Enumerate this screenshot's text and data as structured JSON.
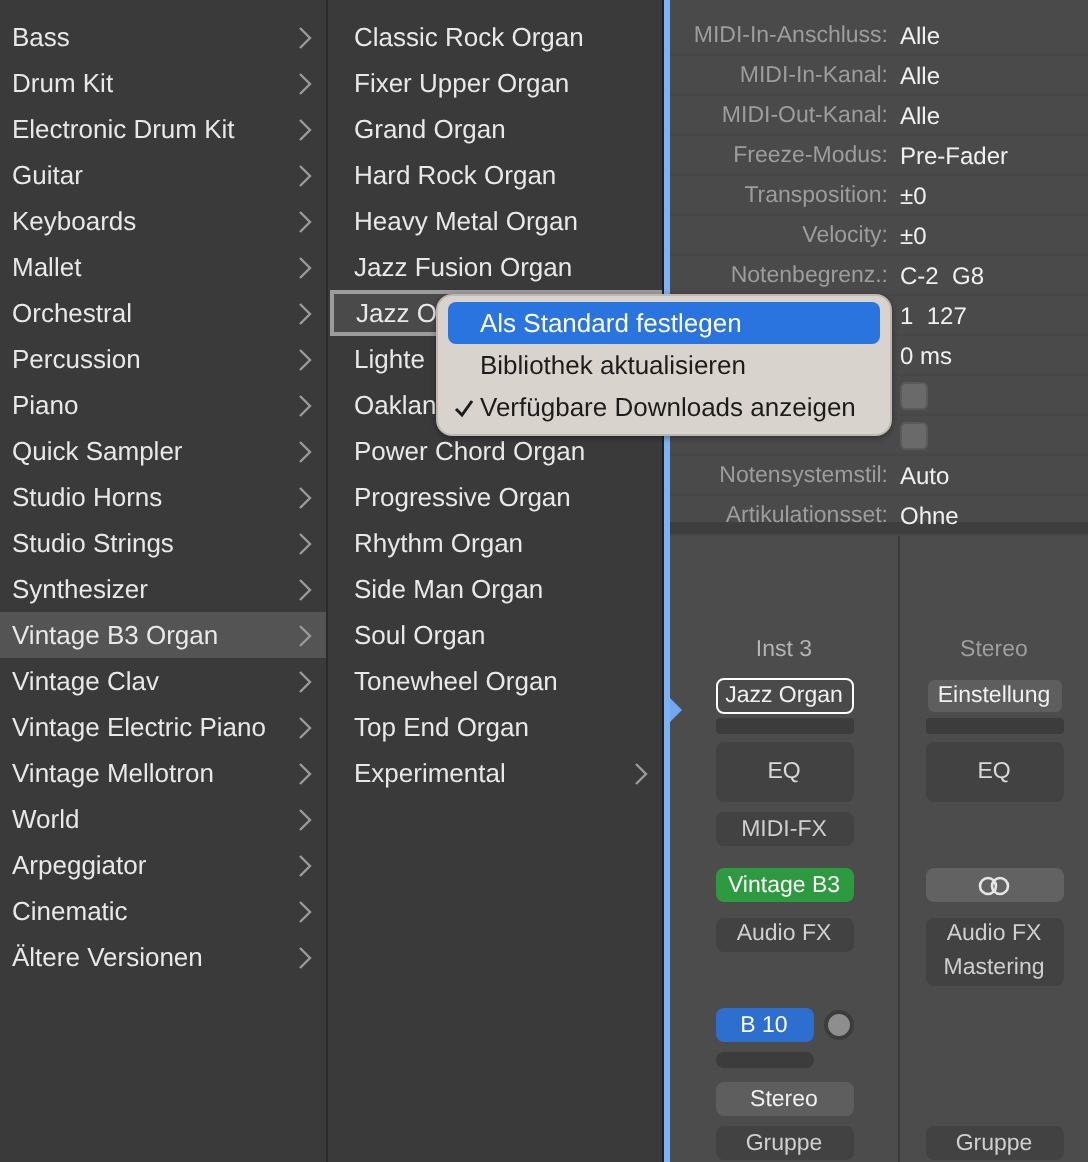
{
  "categories": [
    {
      "label": "Bass",
      "selected": false,
      "submenu": true
    },
    {
      "label": "Drum Kit",
      "selected": false,
      "submenu": true
    },
    {
      "label": "Electronic Drum Kit",
      "selected": false,
      "submenu": true
    },
    {
      "label": "Guitar",
      "selected": false,
      "submenu": true
    },
    {
      "label": "Keyboards",
      "selected": false,
      "submenu": true
    },
    {
      "label": "Mallet",
      "selected": false,
      "submenu": true
    },
    {
      "label": "Orchestral",
      "selected": false,
      "submenu": true
    },
    {
      "label": "Percussion",
      "selected": false,
      "submenu": true
    },
    {
      "label": "Piano",
      "selected": false,
      "submenu": true
    },
    {
      "label": "Quick Sampler",
      "selected": false,
      "submenu": true
    },
    {
      "label": "Studio Horns",
      "selected": false,
      "submenu": true
    },
    {
      "label": "Studio Strings",
      "selected": false,
      "submenu": true
    },
    {
      "label": "Synthesizer",
      "selected": false,
      "submenu": true
    },
    {
      "label": "Vintage B3 Organ",
      "selected": true,
      "submenu": true
    },
    {
      "label": "Vintage Clav",
      "selected": false,
      "submenu": true
    },
    {
      "label": "Vintage Electric Piano",
      "selected": false,
      "submenu": true
    },
    {
      "label": "Vintage Mellotron",
      "selected": false,
      "submenu": true
    },
    {
      "label": "World",
      "selected": false,
      "submenu": true
    },
    {
      "label": "Arpeggiator",
      "selected": false,
      "submenu": true
    },
    {
      "label": "Cinematic",
      "selected": false,
      "submenu": true
    },
    {
      "label": "Ältere Versionen",
      "selected": false,
      "submenu": true
    }
  ],
  "patches": [
    {
      "label": "Classic Rock Organ",
      "selected": false,
      "submenu": false
    },
    {
      "label": "Fixer Upper Organ",
      "selected": false,
      "submenu": false
    },
    {
      "label": "Grand Organ",
      "selected": false,
      "submenu": false
    },
    {
      "label": "Hard Rock Organ",
      "selected": false,
      "submenu": false
    },
    {
      "label": "Heavy Metal Organ",
      "selected": false,
      "submenu": false
    },
    {
      "label": "Jazz Fusion Organ",
      "selected": false,
      "submenu": false
    },
    {
      "label": "Jazz O",
      "selected": true
    },
    {
      "label": "Lighte",
      "selected": false
    },
    {
      "label": "Oaklan",
      "selected": false
    },
    {
      "label": "Power Chord Organ",
      "selected": false,
      "submenu": false
    },
    {
      "label": "Progressive Organ",
      "selected": false,
      "submenu": false
    },
    {
      "label": "Rhythm Organ",
      "selected": false,
      "submenu": false
    },
    {
      "label": "Side Man Organ",
      "selected": false,
      "submenu": false
    },
    {
      "label": "Soul Organ",
      "selected": false,
      "submenu": false
    },
    {
      "label": "Tonewheel Organ",
      "selected": false,
      "submenu": false
    },
    {
      "label": "Top End Organ",
      "selected": false,
      "submenu": false
    },
    {
      "label": "Experimental",
      "selected": false,
      "submenu": true
    }
  ],
  "context_menu": [
    {
      "label": "Als Standard festlegen",
      "selected": true,
      "checked": false
    },
    {
      "label": "Bibliothek aktualisieren",
      "selected": false,
      "checked": false
    },
    {
      "label": "Verfügbare Downloads anzeigen",
      "selected": false,
      "checked": true
    }
  ],
  "inspector": [
    {
      "kind": "text",
      "label": "MIDI-In-Anschluss:",
      "value": "Alle"
    },
    {
      "kind": "text",
      "label": "MIDI-In-Kanal:",
      "value": "Alle"
    },
    {
      "kind": "text",
      "label": "MIDI-Out-Kanal:",
      "value": "Alle"
    },
    {
      "kind": "text",
      "label": "Freeze-Modus:",
      "value": "Pre-Fader"
    },
    {
      "kind": "text",
      "label": "Transposition:",
      "value": "±0"
    },
    {
      "kind": "text",
      "label": "Velocity:",
      "value": "±0"
    },
    {
      "kind": "text",
      "label": "Notenbegrenz.:",
      "value": "C-2  G8"
    },
    {
      "kind": "text",
      "value": "1  127"
    },
    {
      "kind": "text",
      "value": "0 ms"
    },
    {
      "kind": "checkbox",
      "checked": false
    },
    {
      "kind": "checkbox",
      "checked": false
    },
    {
      "kind": "text",
      "label": "Notensystemstil:",
      "value": "Auto"
    },
    {
      "kind": "text",
      "label": "Artikulationsset:",
      "value": "Ohne"
    }
  ],
  "strips": [
    {
      "name": "Inst 3",
      "selected": true,
      "slots": [
        {
          "kind": "setting",
          "label": "Jazz Organ",
          "selected": true
        },
        {
          "kind": "bar"
        },
        {
          "kind": "eq",
          "label": "EQ"
        },
        {
          "kind": "midi_fx",
          "label": "MIDI-FX"
        },
        {
          "kind": "instrument",
          "label": "Vintage B3"
        },
        {
          "kind": "audio_fx",
          "label": "Audio FX"
        },
        {
          "kind": "send",
          "label": "B 10"
        },
        {
          "kind": "bar2"
        },
        {
          "kind": "output",
          "label": "Stereo"
        },
        {
          "kind": "group",
          "label": "Gruppe"
        }
      ]
    },
    {
      "name": "Stereo",
      "selected": false,
      "slots": [
        {
          "kind": "setting",
          "label": "Einstellung",
          "selected": false
        },
        {
          "kind": "bar"
        },
        {
          "kind": "eq",
          "label": "EQ"
        },
        {
          "kind": "link"
        },
        {
          "kind": "audio_fx",
          "label": "Audio FX\nMastering"
        },
        {
          "kind": "group",
          "label": "Gruppe"
        }
      ]
    }
  ]
}
